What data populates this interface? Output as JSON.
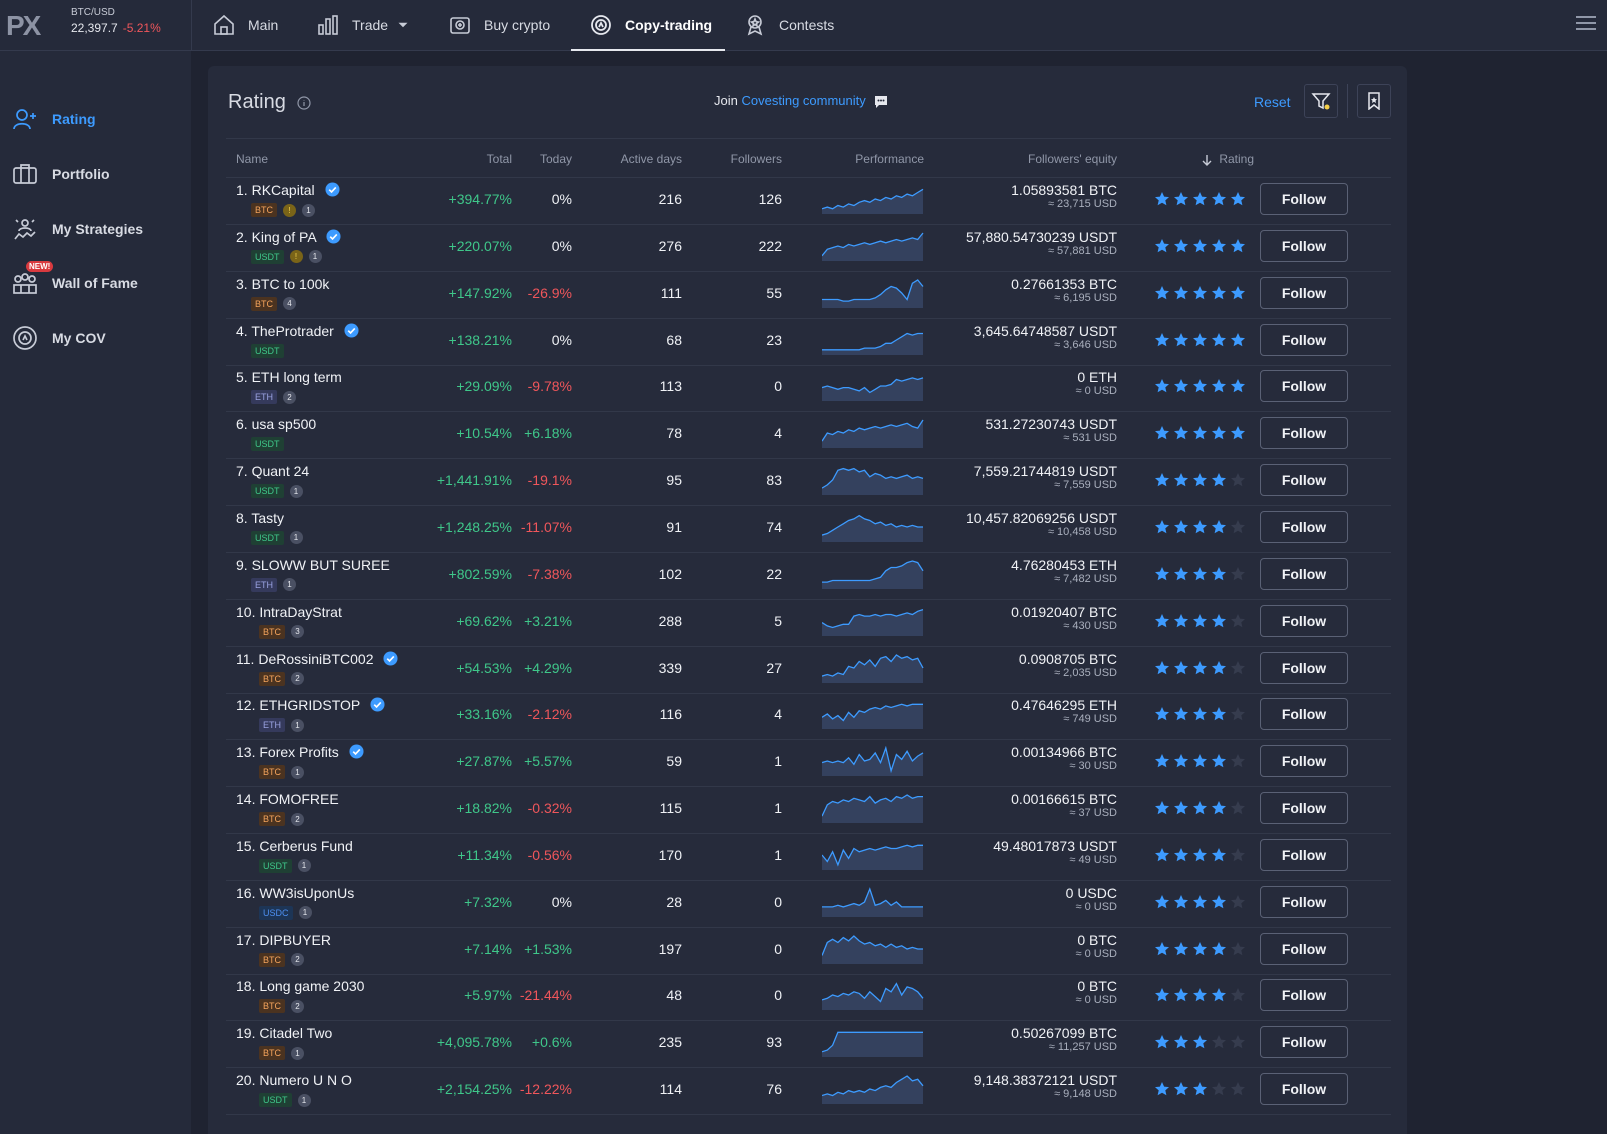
{
  "ticker": {
    "pair": "BTC/USD",
    "price": "22,397.7",
    "change": "-5.21%"
  },
  "logo": "PX",
  "nav": [
    {
      "label": "Main",
      "icon": "home-icon"
    },
    {
      "label": "Trade",
      "icon": "bar-chart-icon"
    },
    {
      "label": "Buy crypto",
      "icon": "wallet-icon"
    },
    {
      "label": "Copy-trading",
      "icon": "copy-trading-icon"
    },
    {
      "label": "Contests",
      "icon": "trophy-icon"
    }
  ],
  "sidebar": {
    "items": [
      {
        "label": "Rating",
        "icon": "user-plus-icon"
      },
      {
        "label": "Portfolio",
        "icon": "briefcase-icon"
      },
      {
        "label": "My Strategies",
        "icon": "strategies-icon"
      },
      {
        "label": "Wall of Fame",
        "icon": "wall-of-fame-icon",
        "badge": "NEW!"
      },
      {
        "label": "My COV",
        "icon": "cov-coin-icon"
      }
    ]
  },
  "panel": {
    "title": "Rating",
    "join_prefix": "Join",
    "join_link": "Covesting community",
    "reset": "Reset"
  },
  "columns": [
    "Name",
    "Total",
    "Today",
    "Active days",
    "Followers",
    "Performance",
    "Followers' equity",
    "Rating"
  ],
  "colors": {
    "accent": "#3d9bff",
    "positive": "#3fc78a",
    "negative": "#f0565b",
    "star": "#3d9bff"
  },
  "follow_label": "Follow",
  "rows": [
    {
      "rank": "1.",
      "name": "RKCapital",
      "verified": true,
      "currency": "BTC",
      "extras": [
        "gold",
        "1"
      ],
      "total": "+394.77%",
      "today": "0%",
      "days": "216",
      "followers": "126",
      "eq1": "1.05893581 BTC",
      "eq2": "≈ 23,715 USD",
      "stars": 5,
      "spark": [
        2,
        3,
        2,
        4,
        3,
        5,
        4,
        6,
        7,
        6,
        8,
        7,
        9,
        8,
        10,
        9,
        11,
        10,
        12,
        14
      ]
    },
    {
      "rank": "2.",
      "name": "King of PA",
      "verified": true,
      "currency": "USDT",
      "extras": [
        "gold",
        "1"
      ],
      "total": "+220.07%",
      "today": "0%",
      "days": "276",
      "followers": "222",
      "eq1": "57,880.54730239 USDT",
      "eq2": "≈ 57,881 USD",
      "stars": 5,
      "spark": [
        2,
        6,
        7,
        8,
        7,
        9,
        8,
        9,
        10,
        9,
        10,
        11,
        10,
        11,
        12,
        11,
        12,
        13,
        12,
        16
      ]
    },
    {
      "rank": "3.",
      "name": "BTC to 100k",
      "verified": false,
      "currency": "BTC",
      "extras": [
        "4"
      ],
      "total": "+147.92%",
      "today": "-26.9%",
      "days": "111",
      "followers": "55",
      "eq1": "0.27661353 BTC",
      "eq2": "≈ 6,195 USD",
      "stars": 5,
      "spark": [
        4,
        4,
        4,
        4,
        3,
        3,
        4,
        4,
        4,
        4,
        5,
        7,
        10,
        12,
        11,
        8,
        4,
        14,
        16,
        12
      ]
    },
    {
      "rank": "4.",
      "name": "TheProtrader",
      "verified": true,
      "currency": "USDT",
      "extras": [],
      "total": "+138.21%",
      "today": "0%",
      "days": "68",
      "followers": "23",
      "eq1": "3,645.64748587 USDT",
      "eq2": "≈ 3,646 USD",
      "stars": 5,
      "spark": [
        2,
        2,
        2,
        2,
        2,
        2,
        2,
        2,
        3,
        3,
        3,
        4,
        6,
        6,
        8,
        10,
        12,
        11,
        12,
        12
      ]
    },
    {
      "rank": "5.",
      "name": "ETH long term",
      "verified": false,
      "currency": "ETH",
      "extras": [
        "2"
      ],
      "total": "+29.09%",
      "today": "-9.78%",
      "days": "113",
      "followers": "0",
      "eq1": "0 ETH",
      "eq2": "≈ 0 USD",
      "stars": 5,
      "spark": [
        7,
        8,
        7,
        6,
        7,
        7,
        6,
        5,
        7,
        4,
        6,
        8,
        8,
        9,
        12,
        11,
        12,
        13,
        12,
        13
      ]
    },
    {
      "rank": "6.",
      "name": "usa sp500",
      "verified": false,
      "currency": "USDT",
      "extras": [],
      "total": "+10.54%",
      "today": "+6.18%",
      "days": "78",
      "followers": "4",
      "eq1": "531.27230743 USDT",
      "eq2": "≈ 531 USD",
      "stars": 5,
      "spark": [
        3,
        8,
        7,
        9,
        8,
        10,
        9,
        11,
        10,
        11,
        12,
        11,
        12,
        13,
        12,
        13,
        14,
        12,
        11,
        16
      ]
    },
    {
      "rank": "7.",
      "name": "Quant 24",
      "verified": false,
      "currency": "USDT",
      "extras": [
        "1"
      ],
      "total": "+1,441.91%",
      "today": "-19.1%",
      "days": "95",
      "followers": "83",
      "eq1": "7,559.21744819 USDT",
      "eq2": "≈ 7,559 USD",
      "stars": 4,
      "spark": [
        3,
        5,
        8,
        14,
        15,
        14,
        15,
        13,
        14,
        10,
        12,
        11,
        9,
        10,
        9,
        10,
        11,
        9,
        10,
        9
      ]
    },
    {
      "rank": "8.",
      "name": "Tasty",
      "verified": false,
      "currency": "USDT",
      "extras": [
        "1"
      ],
      "total": "+1,248.25%",
      "today": "-11.07%",
      "days": "91",
      "followers": "74",
      "eq1": "10,457.82069256 USDT",
      "eq2": "≈ 10,458 USD",
      "stars": 4,
      "spark": [
        3,
        4,
        6,
        8,
        10,
        12,
        13,
        15,
        13,
        12,
        10,
        11,
        9,
        10,
        8,
        9,
        8,
        9,
        8,
        8
      ]
    },
    {
      "rank": "9.",
      "name": "SLOWW BUT SUREE",
      "verified": false,
      "currency": "ETH",
      "extras": [
        "1"
      ],
      "total": "+802.59%",
      "today": "-7.38%",
      "days": "102",
      "followers": "22",
      "eq1": "4.76280453 ETH",
      "eq2": "≈ 7,482 USD",
      "stars": 4,
      "spark": [
        3,
        3,
        4,
        4,
        4,
        4,
        4,
        4,
        4,
        4,
        5,
        6,
        10,
        12,
        12,
        13,
        15,
        16,
        15,
        10
      ]
    },
    {
      "rank": "10.",
      "name": "IntraDayStrat",
      "verified": false,
      "currency": "BTC",
      "extras": [
        "3"
      ],
      "total": "+69.62%",
      "today": "+3.21%",
      "days": "288",
      "followers": "5",
      "eq1": "0.01920407 BTC",
      "eq2": "≈ 430 USD",
      "stars": 4,
      "spark": [
        7,
        5,
        4,
        5,
        6,
        6,
        11,
        12,
        11,
        11,
        12,
        11,
        12,
        12,
        11,
        12,
        13,
        12,
        14,
        15
      ]
    },
    {
      "rank": "11.",
      "name": "DeRossiniBTC002",
      "verified": true,
      "currency": "BTC",
      "extras": [
        "2"
      ],
      "total": "+54.53%",
      "today": "+4.29%",
      "days": "339",
      "followers": "27",
      "eq1": "0.0908705 BTC",
      "eq2": "≈ 2,035 USD",
      "stars": 4,
      "spark": [
        3,
        4,
        3,
        5,
        4,
        9,
        8,
        12,
        10,
        13,
        9,
        14,
        15,
        12,
        16,
        14,
        15,
        13,
        14,
        8
      ]
    },
    {
      "rank": "12.",
      "name": "ETHGRIDSTOP",
      "verified": true,
      "currency": "ETH",
      "extras": [
        "1"
      ],
      "total": "+33.16%",
      "today": "-2.12%",
      "days": "116",
      "followers": "4",
      "eq1": "0.47646295 ETH",
      "eq2": "≈ 749 USD",
      "stars": 4,
      "spark": [
        6,
        8,
        5,
        7,
        4,
        9,
        6,
        10,
        9,
        11,
        12,
        11,
        13,
        12,
        13,
        14,
        13,
        14,
        14,
        14
      ]
    },
    {
      "rank": "13.",
      "name": "Forex Profits",
      "verified": true,
      "currency": "BTC",
      "extras": [
        "1"
      ],
      "total": "+27.87%",
      "today": "+5.57%",
      "days": "59",
      "followers": "1",
      "eq1": "0.00134966 BTC",
      "eq2": "≈ 30 USD",
      "stars": 4,
      "spark": [
        7,
        8,
        7,
        8,
        7,
        10,
        6,
        12,
        8,
        9,
        13,
        7,
        16,
        2,
        12,
        9,
        14,
        8,
        11,
        13
      ]
    },
    {
      "rank": "14.",
      "name": "FOMOFREE",
      "verified": false,
      "currency": "BTC",
      "extras": [
        "2"
      ],
      "total": "+18.82%",
      "today": "-0.32%",
      "days": "115",
      "followers": "1",
      "eq1": "0.00166615 BTC",
      "eq2": "≈ 37 USD",
      "stars": 4,
      "spark": [
        3,
        10,
        12,
        11,
        13,
        12,
        14,
        13,
        12,
        15,
        11,
        13,
        14,
        12,
        15,
        14,
        16,
        14,
        15,
        15
      ]
    },
    {
      "rank": "15.",
      "name": "Cerberus Fund",
      "verified": false,
      "currency": "USDT",
      "extras": [
        "1"
      ],
      "total": "+11.34%",
      "today": "-0.56%",
      "days": "170",
      "followers": "1",
      "eq1": "49.48017873 USDT",
      "eq2": "≈ 49 USD",
      "stars": 4,
      "spark": [
        8,
        4,
        10,
        2,
        11,
        6,
        12,
        10,
        11,
        12,
        11,
        12,
        13,
        12,
        12,
        13,
        14,
        13,
        14,
        14
      ]
    },
    {
      "rank": "16.",
      "name": "WW3isUponUs",
      "verified": false,
      "currency": "USDC",
      "extras": [
        "1"
      ],
      "total": "+7.32%",
      "today": "0%",
      "days": "28",
      "followers": "0",
      "eq1": "0 USDC",
      "eq2": "≈ 0 USD",
      "stars": 4,
      "spark": [
        5,
        5,
        5,
        6,
        5,
        6,
        7,
        6,
        8,
        16,
        6,
        7,
        9,
        6,
        8,
        5,
        5,
        5,
        5,
        5
      ]
    },
    {
      "rank": "17.",
      "name": "DIPBUYER",
      "verified": false,
      "currency": "BTC",
      "extras": [
        "2"
      ],
      "total": "+7.14%",
      "today": "+1.53%",
      "days": "197",
      "followers": "0",
      "eq1": "0 BTC",
      "eq2": "≈ 0 USD",
      "stars": 4,
      "spark": [
        4,
        12,
        14,
        12,
        15,
        13,
        16,
        13,
        11,
        12,
        10,
        11,
        9,
        11,
        9,
        10,
        8,
        9,
        8,
        8
      ]
    },
    {
      "rank": "18.",
      "name": "Long game 2030",
      "verified": false,
      "currency": "BTC",
      "extras": [
        "2"
      ],
      "total": "+5.97%",
      "today": "-21.44%",
      "days": "48",
      "followers": "0",
      "eq1": "0 BTC",
      "eq2": "≈ 0 USD",
      "stars": 4,
      "spark": [
        5,
        6,
        8,
        7,
        9,
        8,
        10,
        9,
        6,
        10,
        7,
        4,
        12,
        10,
        15,
        8,
        13,
        12,
        10,
        6
      ]
    },
    {
      "rank": "19.",
      "name": "Citadel Two",
      "verified": false,
      "currency": "BTC",
      "extras": [
        "1"
      ],
      "total": "+4,095.78%",
      "today": "+0.6%",
      "days": "235",
      "followers": "93",
      "eq1": "0.50267099 BTC",
      "eq2": "≈ 11,257 USD",
      "stars": 3,
      "spark": [
        2,
        3,
        6,
        14,
        14,
        14,
        14,
        14,
        14,
        14,
        14,
        14,
        14,
        14,
        14,
        14,
        14,
        14,
        14,
        14
      ]
    },
    {
      "rank": "20.",
      "name": "Numero U N O",
      "verified": false,
      "currency": "USDT",
      "extras": [
        "1"
      ],
      "total": "+2,154.25%",
      "today": "-12.22%",
      "days": "114",
      "followers": "76",
      "eq1": "9,148.38372121 USDT",
      "eq2": "≈ 9,148 USD",
      "stars": 3,
      "spark": [
        4,
        5,
        4,
        6,
        5,
        7,
        6,
        7,
        6,
        8,
        7,
        9,
        10,
        9,
        12,
        14,
        16,
        13,
        14,
        10
      ]
    }
  ]
}
